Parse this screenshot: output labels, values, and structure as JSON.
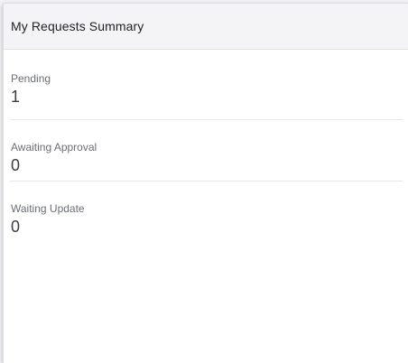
{
  "panel": {
    "title": "My Requests Summary"
  },
  "summary": {
    "items": [
      {
        "label": "Pending",
        "value": "1"
      },
      {
        "label": "Awaiting Approval",
        "value": "0"
      },
      {
        "label": "Waiting Update",
        "value": "0"
      }
    ]
  }
}
